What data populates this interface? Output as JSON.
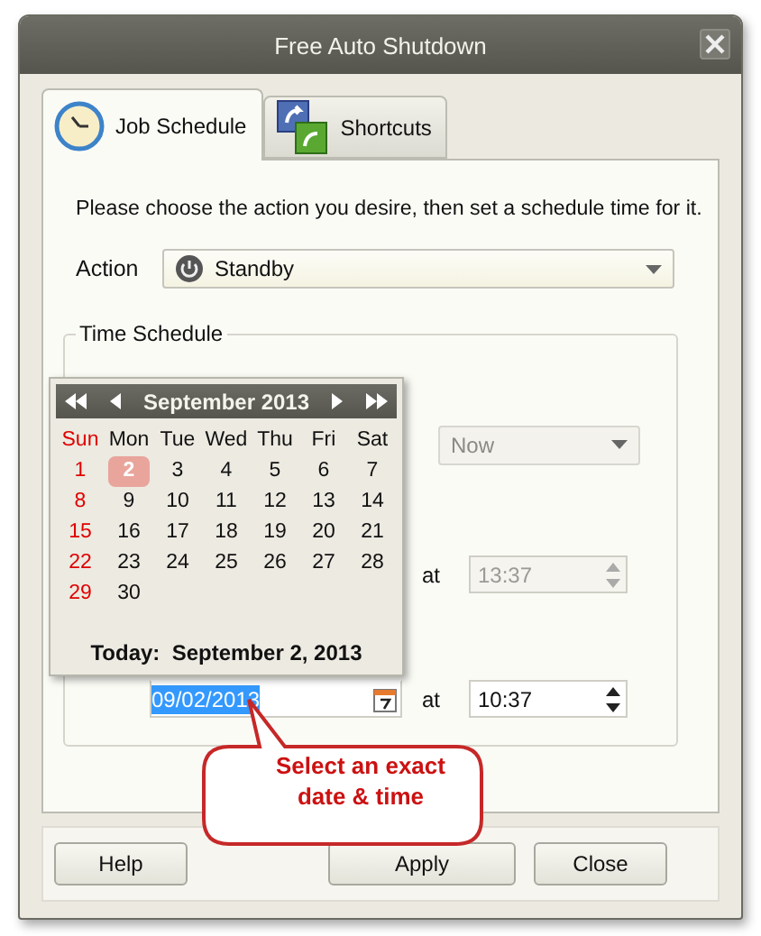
{
  "window": {
    "title": "Free Auto Shutdown"
  },
  "tabs": [
    {
      "label": "Job Schedule",
      "kind": "clock",
      "selected": true
    },
    {
      "label": "Shortcuts",
      "kind": "shortcut",
      "selected": false
    }
  ],
  "intro": "Please choose the action you desire, then set a schedule time for it.",
  "action": {
    "label": "Action",
    "value": "Standby"
  },
  "time_schedule": {
    "title": "Time Schedule",
    "start": {
      "value": "Now",
      "disabled": true
    },
    "countdown": {
      "at": "at",
      "time": "13:37",
      "disabled": true
    },
    "exact": {
      "date": "09/02/2013",
      "at": "at",
      "time": "10:37",
      "disabled": false
    }
  },
  "calendar": {
    "month": "September 2013",
    "weekdays": [
      "Sun",
      "Mon",
      "Tue",
      "Wed",
      "Thu",
      "Fri",
      "Sat"
    ],
    "weeks": [
      [
        {
          "day": "1",
          "selected": false
        },
        {
          "day": "2",
          "selected": true
        },
        {
          "day": "3",
          "selected": false
        },
        {
          "day": "4",
          "selected": false
        },
        {
          "day": "5",
          "selected": false
        },
        {
          "day": "6",
          "selected": false
        },
        {
          "day": "7",
          "selected": false
        }
      ],
      [
        {
          "day": "8",
          "selected": false
        },
        {
          "day": "9",
          "selected": false
        },
        {
          "day": "10",
          "selected": false
        },
        {
          "day": "11",
          "selected": false
        },
        {
          "day": "12",
          "selected": false
        },
        {
          "day": "13",
          "selected": false
        },
        {
          "day": "14",
          "selected": false
        }
      ],
      [
        {
          "day": "15",
          "selected": false
        },
        {
          "day": "16",
          "selected": false
        },
        {
          "day": "17",
          "selected": false
        },
        {
          "day": "18",
          "selected": false
        },
        {
          "day": "19",
          "selected": false
        },
        {
          "day": "20",
          "selected": false
        },
        {
          "day": "21",
          "selected": false
        }
      ],
      [
        {
          "day": "22",
          "selected": false
        },
        {
          "day": "23",
          "selected": false
        },
        {
          "day": "24",
          "selected": false
        },
        {
          "day": "25",
          "selected": false
        },
        {
          "day": "26",
          "selected": false
        },
        {
          "day": "27",
          "selected": false
        },
        {
          "day": "28",
          "selected": false
        }
      ],
      [
        {
          "day": "29",
          "selected": false
        },
        {
          "day": "30",
          "selected": false
        }
      ]
    ],
    "today_label": "Today:",
    "today_date": "September 2, 2013"
  },
  "callout": "Select an exact date & time",
  "buttons": [
    {
      "label": "Help"
    },
    {
      "label": "Apply"
    },
    {
      "label": "Close"
    }
  ]
}
